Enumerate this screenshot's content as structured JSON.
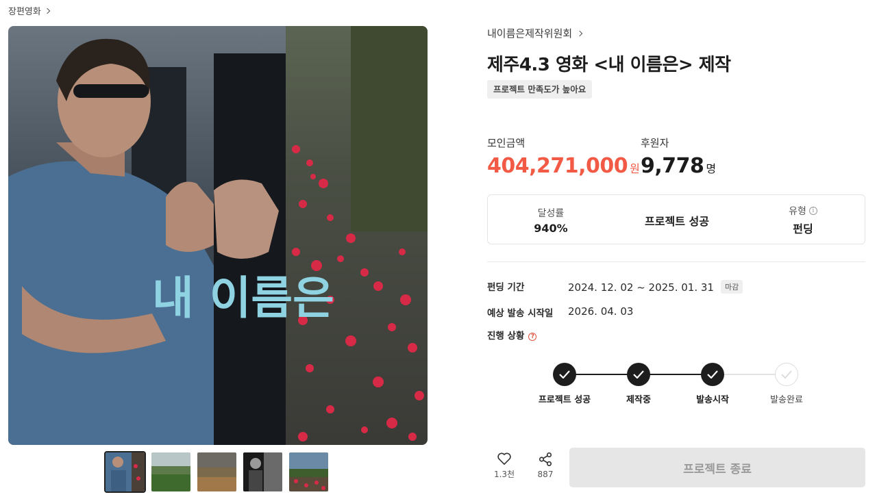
{
  "breadcrumb": {
    "category": "장편영화"
  },
  "main_image": {
    "overlay_text": "내 이름은"
  },
  "thumbnails": [
    {
      "icon": "poster-photo",
      "active": true
    },
    {
      "icon": "landscape-photo",
      "active": false
    },
    {
      "icon": "landscape-photo",
      "active": false
    },
    {
      "icon": "bw-photo",
      "active": false
    },
    {
      "icon": "flower-field-photo",
      "active": false
    }
  ],
  "project": {
    "creator": "내이름은제작위원회",
    "title": "제주4.3 영화 <내 이름은> 제작",
    "satisfaction_tag": "프로젝트 만족도가 높아요"
  },
  "stats": {
    "amount_label": "모인금액",
    "amount_value": "404,271,000",
    "amount_unit": "원",
    "backers_label": "후원자",
    "backers_value": "9,778",
    "backers_unit": "명"
  },
  "summary_box": {
    "rate_label": "달성률",
    "rate_value": "940%",
    "status": "프로젝트 성공",
    "type_label": "유형",
    "type_value": "펀딩"
  },
  "details": {
    "period_label": "펀딩 기간",
    "period_value": "2024. 12. 02 ~ 2025. 01. 31",
    "closed_badge": "마감",
    "ship_label": "예상 발송 시작일",
    "ship_value": "2026. 04. 03",
    "progress_label": "진행 상황"
  },
  "progress_steps": [
    {
      "label": "프로젝트 성공",
      "done": true
    },
    {
      "label": "제작중",
      "done": true
    },
    {
      "label": "발송시작",
      "done": true
    },
    {
      "label": "발송완료",
      "done": false
    }
  ],
  "actions": {
    "like_count": "1.3천",
    "share_count": "887",
    "end_button": "프로젝트 종료"
  },
  "colors": {
    "accent": "#f25a45",
    "dark": "#1d1d1d",
    "overlay_text": "#8fd3e3"
  }
}
